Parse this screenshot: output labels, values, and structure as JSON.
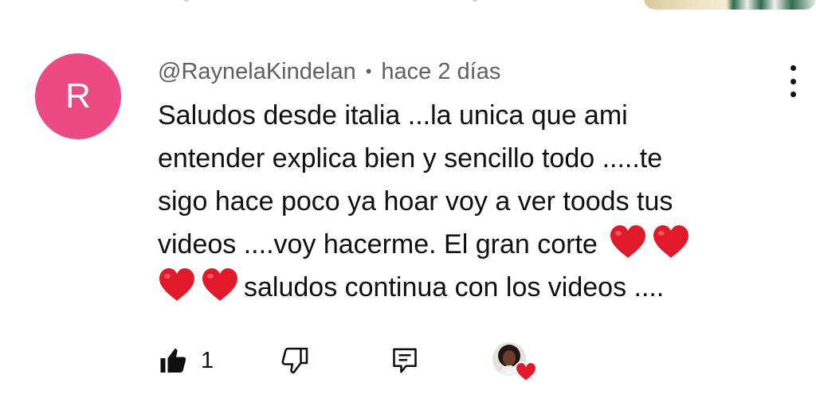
{
  "comment": {
    "author": "@RaynelaKindelan",
    "separator": "•",
    "time": "hace 2 días",
    "avatar_letter": "R",
    "avatar_color": "#ec4a85",
    "text_lines": [
      "Saludos desde italia ...la unica que ami",
      "entender explica bien y sencillo todo .....te",
      "sigo hace poco ya hoar voy a ver toods tus",
      "videos ....voy hacerme. El gran corte",
      "saludos continua con los videos ...."
    ],
    "emoji_hearts": "❤️❤️",
    "like_count": "1"
  },
  "icons": {
    "more": "vertical-ellipsis-icon",
    "like": "thumbs-up-icon",
    "dislike": "thumbs-down-icon",
    "reply": "reply-icon",
    "creator_heart": "creator-heart-badge"
  },
  "colors": {
    "heart": "#e0192b",
    "meta_text": "#606060"
  }
}
